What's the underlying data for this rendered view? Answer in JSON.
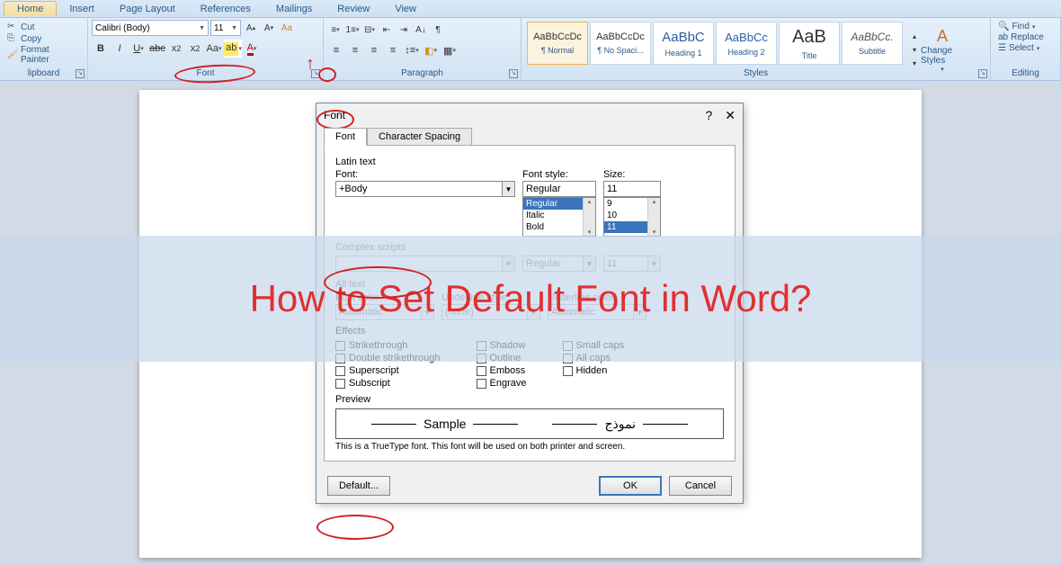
{
  "overlay": {
    "headline": "How to Set Default Font in Word?"
  },
  "tabs": [
    "Home",
    "Insert",
    "Page Layout",
    "References",
    "Mailings",
    "Review",
    "View"
  ],
  "clipboard": {
    "cut": "Cut",
    "copy": "Copy",
    "painter": "Format Painter",
    "label": "lipboard"
  },
  "font_group": {
    "label": "Font",
    "font_name": "Calibri (Body)",
    "font_size": "11"
  },
  "paragraph_group": {
    "label": "Paragraph"
  },
  "styles_group": {
    "label": "Styles",
    "change": "Change Styles",
    "items": [
      {
        "sample": "AaBbCcDc",
        "name": "¶ Normal",
        "sel": true,
        "color": "#333",
        "fs": "11px"
      },
      {
        "sample": "AaBbCcDc",
        "name": "¶ No Spaci...",
        "sel": false,
        "color": "#333",
        "fs": "11px"
      },
      {
        "sample": "AaBbC",
        "name": "Heading 1",
        "sel": false,
        "color": "#2a5fa8",
        "fs": "15px"
      },
      {
        "sample": "AaBbCc",
        "name": "Heading 2",
        "sel": false,
        "color": "#2a5fa8",
        "fs": "13px"
      },
      {
        "sample": "AaB",
        "name": "Title",
        "sel": false,
        "color": "#333",
        "fs": "20px"
      },
      {
        "sample": "AaBbCc.",
        "name": "Subtitle",
        "sel": false,
        "color": "#555",
        "fs": "12px",
        "italic": true
      }
    ]
  },
  "editing_group": {
    "label": "Editing",
    "find": "Find",
    "replace": "Replace",
    "select": "Select"
  },
  "dialog": {
    "title": "Font",
    "tabs": [
      "Font",
      "Character Spacing"
    ],
    "latin_label": "Latin text",
    "font_label": "Font:",
    "font_value": "+Body",
    "style_label": "Font style:",
    "style_value": "Regular",
    "style_options": [
      "Regular",
      "Italic",
      "Bold"
    ],
    "size_label": "Size:",
    "size_value": "11",
    "size_options": [
      "9",
      "10",
      "11"
    ],
    "complex_label": "Complex scripts",
    "all_text_label": "All text",
    "color_label": "Font color:",
    "color_value": "Automatic",
    "ustyle_label": "Underline style:",
    "ustyle_value": "(none)",
    "ucolor_label": "Underline color:",
    "ucolor_value": "Automatic",
    "effects_label": "Effects",
    "effects_col1": [
      "Strikethrough",
      "Double strikethrough",
      "Superscript",
      "Subscript"
    ],
    "effects_col2": [
      "Shadow",
      "Outline",
      "Emboss",
      "Engrave"
    ],
    "effects_col3": [
      "Small caps",
      "All caps",
      "Hidden"
    ],
    "preview_label": "Preview",
    "preview_sample1": "Sample",
    "preview_sample2": "نموذج",
    "preview_note": "This is a TrueType font. This font will be used on both printer and screen.",
    "btn_default": "Default...",
    "btn_ok": "OK",
    "btn_cancel": "Cancel"
  }
}
